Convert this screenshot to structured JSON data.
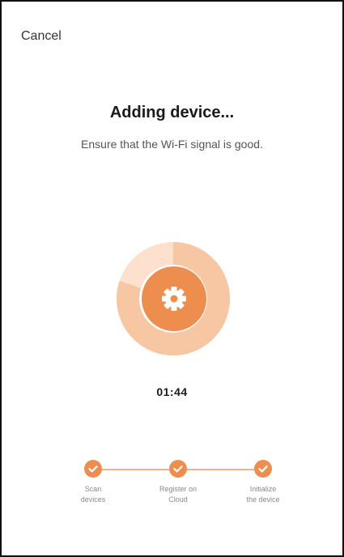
{
  "header": {
    "cancel_label": "Cancel"
  },
  "main": {
    "title": "Adding device...",
    "subtitle": "Ensure that the Wi-Fi signal is good.",
    "timer": "01:44",
    "center_icon": "gear-icon",
    "progress_fraction": 0.8
  },
  "steps": [
    {
      "label": "Scan\ndevices",
      "icon": "check-icon",
      "status": "done"
    },
    {
      "label": "Register on\nCloud",
      "icon": "check-icon",
      "status": "done"
    },
    {
      "label": "Initialize\nthe device",
      "icon": "check-icon",
      "status": "done"
    }
  ],
  "colors": {
    "accent": "#ee8e4e",
    "ring_light": "#fde0cd",
    "ring_progress": "#f7c6a3",
    "line": "#e8b599"
  }
}
